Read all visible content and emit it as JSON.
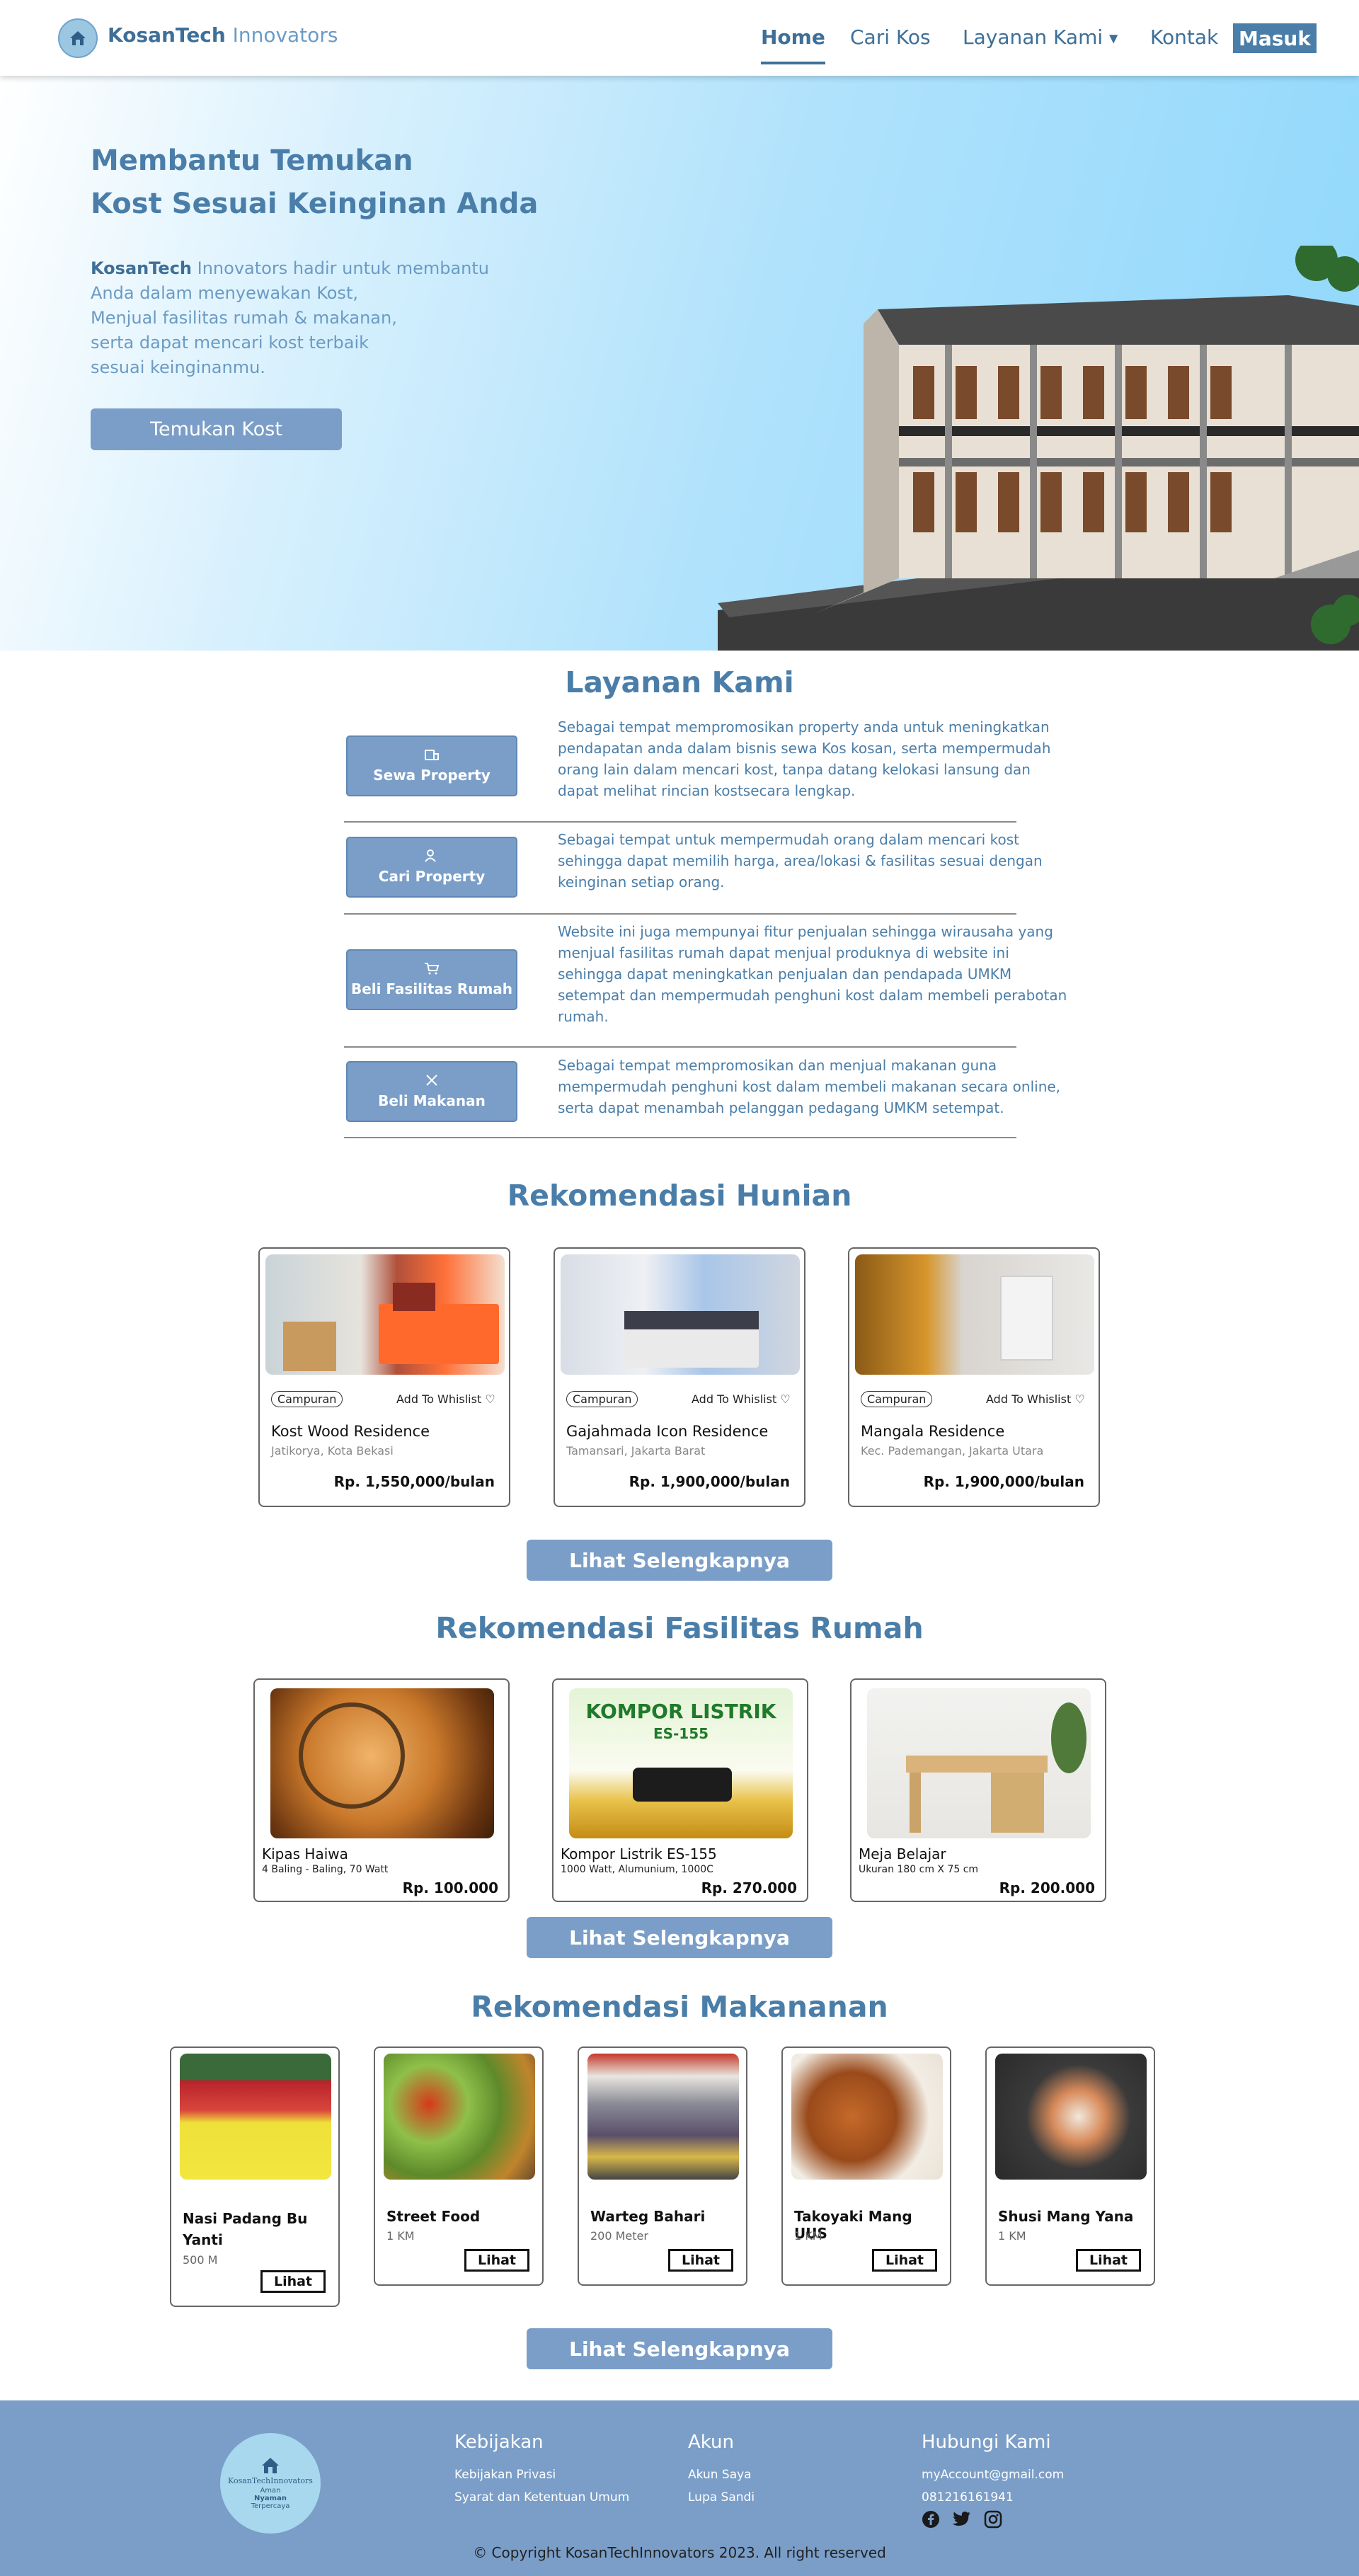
{
  "navbar": {
    "brand_bold": "KosanTech",
    "brand_light": "Innovators",
    "links": [
      "Home",
      "Cari Kos",
      "Layanan Kami",
      "Kontak"
    ],
    "login": "Masuk"
  },
  "hero": {
    "title_line1": "Membantu Temukan",
    "title_line2": "Kost Sesuai Keinginan Anda",
    "desc_bold": "KosanTech",
    "desc_l1": " Innovators hadir untuk membantu",
    "desc_l2": "Anda dalam menyewakan Kost,",
    "desc_l3": "Menjual fasilitas rumah & makanan,",
    "desc_l4": "serta dapat mencari kost terbaik",
    "desc_l5": "sesuai keinginanmu.",
    "cta": "Temukan Kost"
  },
  "layanan": {
    "title": "Layanan Kami",
    "items": [
      {
        "label": "Sewa Property",
        "icon": "building-icon",
        "text": "Sebagai tempat mempromosikan property anda untuk meningkatkan pendapatan anda dalam bisnis sewa Kos kosan, serta mempermudah orang lain dalam mencari kost, tanpa datang kelokasi lansung dan dapat melihat rincian kostsecara lengkap."
      },
      {
        "label": "Cari Property",
        "icon": "person-search-icon",
        "text": "Sebagai tempat untuk mempermudah orang dalam mencari kost sehingga dapat memilih harga, area/lokasi & fasilitas sesuai dengan keinginan setiap orang."
      },
      {
        "label": "Beli Fasilitas Rumah",
        "icon": "cart-icon",
        "text": "Website ini juga mempunyai fitur penjualan sehingga wirausaha yang menjual fasilitas rumah dapat menjual produknya di website ini sehingga dapat meningkatkan penjualan dan pendapada UMKM setempat dan mempermudah penghuni kost dalam membeli perabotan rumah."
      },
      {
        "label": "Beli Makanan",
        "icon": "utensils-icon",
        "text": "Sebagai tempat mempromosikan dan menjual makanan guna mempermudah penghuni kost dalam membeli makanan secara online, serta dapat menambah pelanggan pedagang UMKM setempat."
      }
    ]
  },
  "hunian": {
    "title": "Rekomendasi Hunian",
    "items": [
      {
        "tag": "Campuran",
        "wishlist": "Add To Whislist",
        "name": "Kost Wood Residence",
        "location": "Jatikorya, Kota Bekasi",
        "price": "Rp. 1,550,000/bulan"
      },
      {
        "tag": "Campuran",
        "wishlist": "Add To Whislist",
        "name": "Gajahmada Icon Residence",
        "location": "Tamansari, Jakarta Barat",
        "price": "Rp. 1,900,000/bulan"
      },
      {
        "tag": "Campuran",
        "wishlist": "Add To Whislist",
        "name": "Mangala Residence",
        "location": "Kec. Pademangan, Jakarta Utara",
        "price": "Rp. 1,900,000/bulan"
      }
    ],
    "more": "Lihat Selengkapnya"
  },
  "fasilitas": {
    "title": "Rekomendasi Fasilitas Rumah",
    "items": [
      {
        "name": "Kipas Haiwa",
        "desc": "4 Baling - Baling, 70 Watt",
        "price": "Rp. 100.000"
      },
      {
        "name": "Kompor Listrik ES-155",
        "desc": "1000 Watt, Alumunium, 1000C",
        "price": "Rp. 270.000",
        "img_text1": "KOMPOR LISTRIK",
        "img_text2": "ES-155"
      },
      {
        "name": "Meja Belajar",
        "desc": "Ukuran 180 cm X 75 cm",
        "price": "Rp. 200.000"
      }
    ],
    "more": "Lihat Selengkapnya"
  },
  "makanan": {
    "title": "Rekomendasi Makananan",
    "items": [
      {
        "name": "Nasi Padang Bu Yanti",
        "distance": "500 M",
        "btn": "Lihat"
      },
      {
        "name": "Street Food",
        "distance": "1 KM",
        "btn": "Lihat"
      },
      {
        "name": "Warteg Bahari",
        "distance": "200 Meter",
        "btn": "Lihat"
      },
      {
        "name": "Takoyaki Mang UUS",
        "distance": "1 KM",
        "btn": "Lihat"
      },
      {
        "name": "Shusi Mang Yana",
        "distance": "1 KM",
        "btn": "Lihat"
      }
    ],
    "more": "Lihat Selengkapnya"
  },
  "footer": {
    "logo_text": "KosanTechInnovators",
    "logo_sub1": "Aman",
    "logo_sub2": "Nyaman",
    "logo_sub3": "Terpercaya",
    "kebijakan_title": "Kebijakan",
    "kebijakan": [
      "Kebijakan Privasi",
      "Syarat dan Ketentuan Umum"
    ],
    "akun_title": "Akun",
    "akun": [
      "Akun Saya",
      "Lupa Sandi"
    ],
    "kontak_title": "Hubungi Kami",
    "email": "myAccount@gmail.com",
    "phone": "081216161941",
    "copyright": "© Copyright KosanTechInnovators 2023. All right reserved"
  }
}
